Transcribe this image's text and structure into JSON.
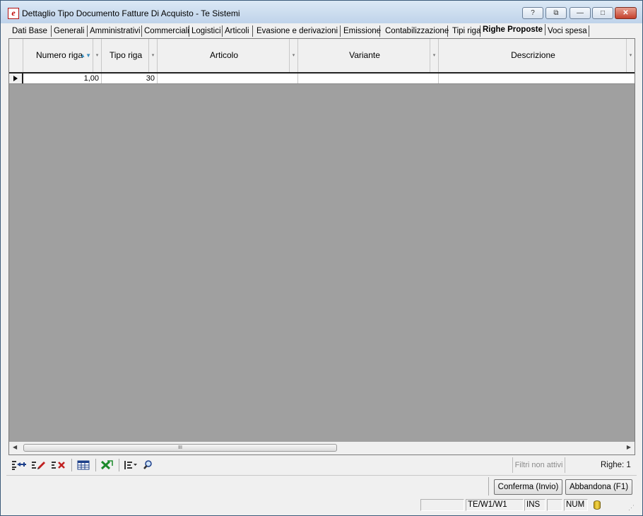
{
  "window": {
    "app_icon": "e",
    "title": "Dettaglio Tipo Documento Fatture Di Acquisto - Te  Sistemi",
    "buttons": {
      "help": "?",
      "restore_alt": "⧉",
      "minimize": "—",
      "maximize": "□",
      "close": "✕"
    }
  },
  "tabs": [
    {
      "label": "Dati Base"
    },
    {
      "label": "Generali"
    },
    {
      "label": "Amministrativi"
    },
    {
      "label": "Commerciali"
    },
    {
      "label": "Logistici"
    },
    {
      "label": "Articoli"
    },
    {
      "label": "Evasione e derivazioni"
    },
    {
      "label": "Emissione"
    },
    {
      "label": "Contabilizzazione"
    },
    {
      "label": "Tipi riga"
    },
    {
      "label": "Righe Proposte",
      "active": true
    },
    {
      "label": "Voci spesa"
    }
  ],
  "grid": {
    "columns": [
      {
        "label": "Numero riga",
        "sorted": "▲▼"
      },
      {
        "label": "Tipo riga"
      },
      {
        "label": "Articolo"
      },
      {
        "label": "Variante"
      },
      {
        "label": "Descrizione"
      }
    ],
    "drop_glyph": "▾",
    "rows": [
      {
        "numero_riga": "1,00",
        "tipo_riga": "30",
        "articolo": "",
        "variante": "",
        "descrizione": ""
      }
    ]
  },
  "scrollbar": {
    "left": "◀",
    "right": "▶",
    "grip": "III"
  },
  "footer": {
    "filters_label": "Filtri non attivi",
    "rows_label": "Righe: 1"
  },
  "actions": {
    "confirm": "Conferma (Invio)",
    "cancel": "Abbandona (F1)"
  },
  "status": {
    "cell1": "",
    "path": "TE/W1/W1",
    "ins": "INS",
    "cell4": "",
    "num": "NUM"
  },
  "colors": {
    "grid_bg": "#a0a0a0",
    "accent_sort": "#3a8fc0",
    "close_button": "#c4402c"
  }
}
